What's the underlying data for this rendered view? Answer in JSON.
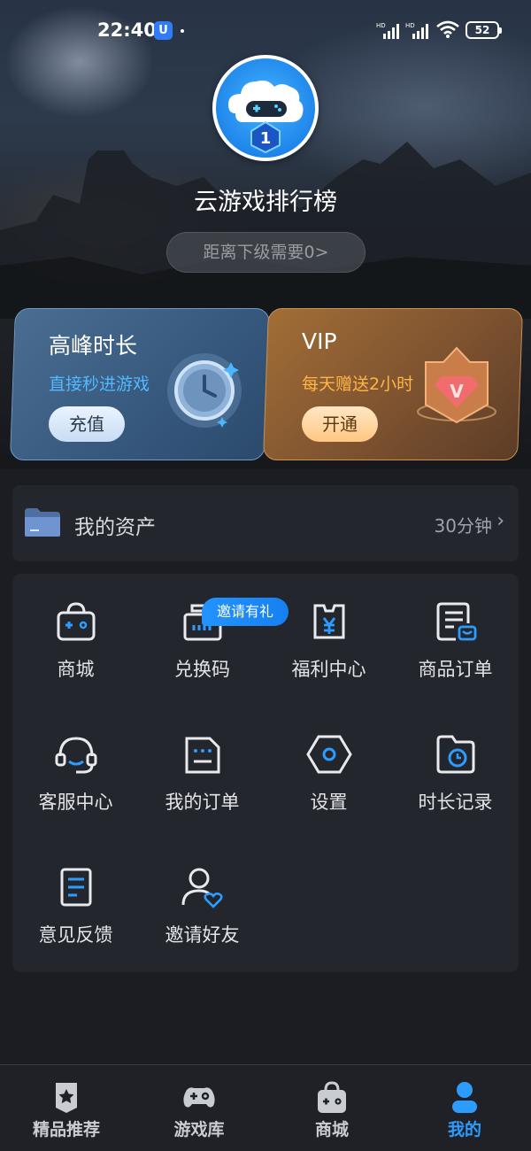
{
  "status_bar": {
    "time": "22:40",
    "app_badge": "U",
    "network_labels": [
      "HD",
      "HD"
    ],
    "battery": "52"
  },
  "profile": {
    "avatar_icon": "cloud-gamepad-avatar",
    "avatar_level": "1",
    "username": "云游戏排行榜",
    "level_progress": "距离下级需要0>"
  },
  "cards": {
    "peak": {
      "title": "高峰时长",
      "subtitle": "直接秒进游戏",
      "button": "充值",
      "icon": "clock-icon"
    },
    "vip": {
      "title": "VIP",
      "subtitle": "每天赠送2小时",
      "button": "开通",
      "icon": "diamond-v-icon",
      "emblem_letter": "V"
    }
  },
  "assets": {
    "title": "我的资产",
    "value": "30分钟",
    "chevron": "›",
    "icon": "folder-icon"
  },
  "menu": {
    "promo_badge": "邀请有礼",
    "items": [
      {
        "label": "商城",
        "icon": "shopping-bag-icon"
      },
      {
        "label": "兑换码",
        "icon": "redeem-code-icon"
      },
      {
        "label": "福利中心",
        "icon": "welfare-icon"
      },
      {
        "label": "商品订单",
        "icon": "product-order-icon"
      },
      {
        "label": "客服中心",
        "icon": "headset-icon"
      },
      {
        "label": "我的订单",
        "icon": "order-doc-icon"
      },
      {
        "label": "设置",
        "icon": "settings-hex-icon"
      },
      {
        "label": "时长记录",
        "icon": "time-record-icon"
      },
      {
        "label": "意见反馈",
        "icon": "feedback-icon"
      },
      {
        "label": "邀请好友",
        "icon": "invite-friend-icon"
      }
    ]
  },
  "tabbar": {
    "active_color": "#2c9dff",
    "items": [
      {
        "label": "精品推荐",
        "icon": "star-badge-icon",
        "active": false
      },
      {
        "label": "游戏库",
        "icon": "gamepad-icon",
        "active": false
      },
      {
        "label": "商城",
        "icon": "store-bag-icon",
        "active": false
      },
      {
        "label": "我的",
        "icon": "user-icon",
        "active": true
      }
    ]
  }
}
